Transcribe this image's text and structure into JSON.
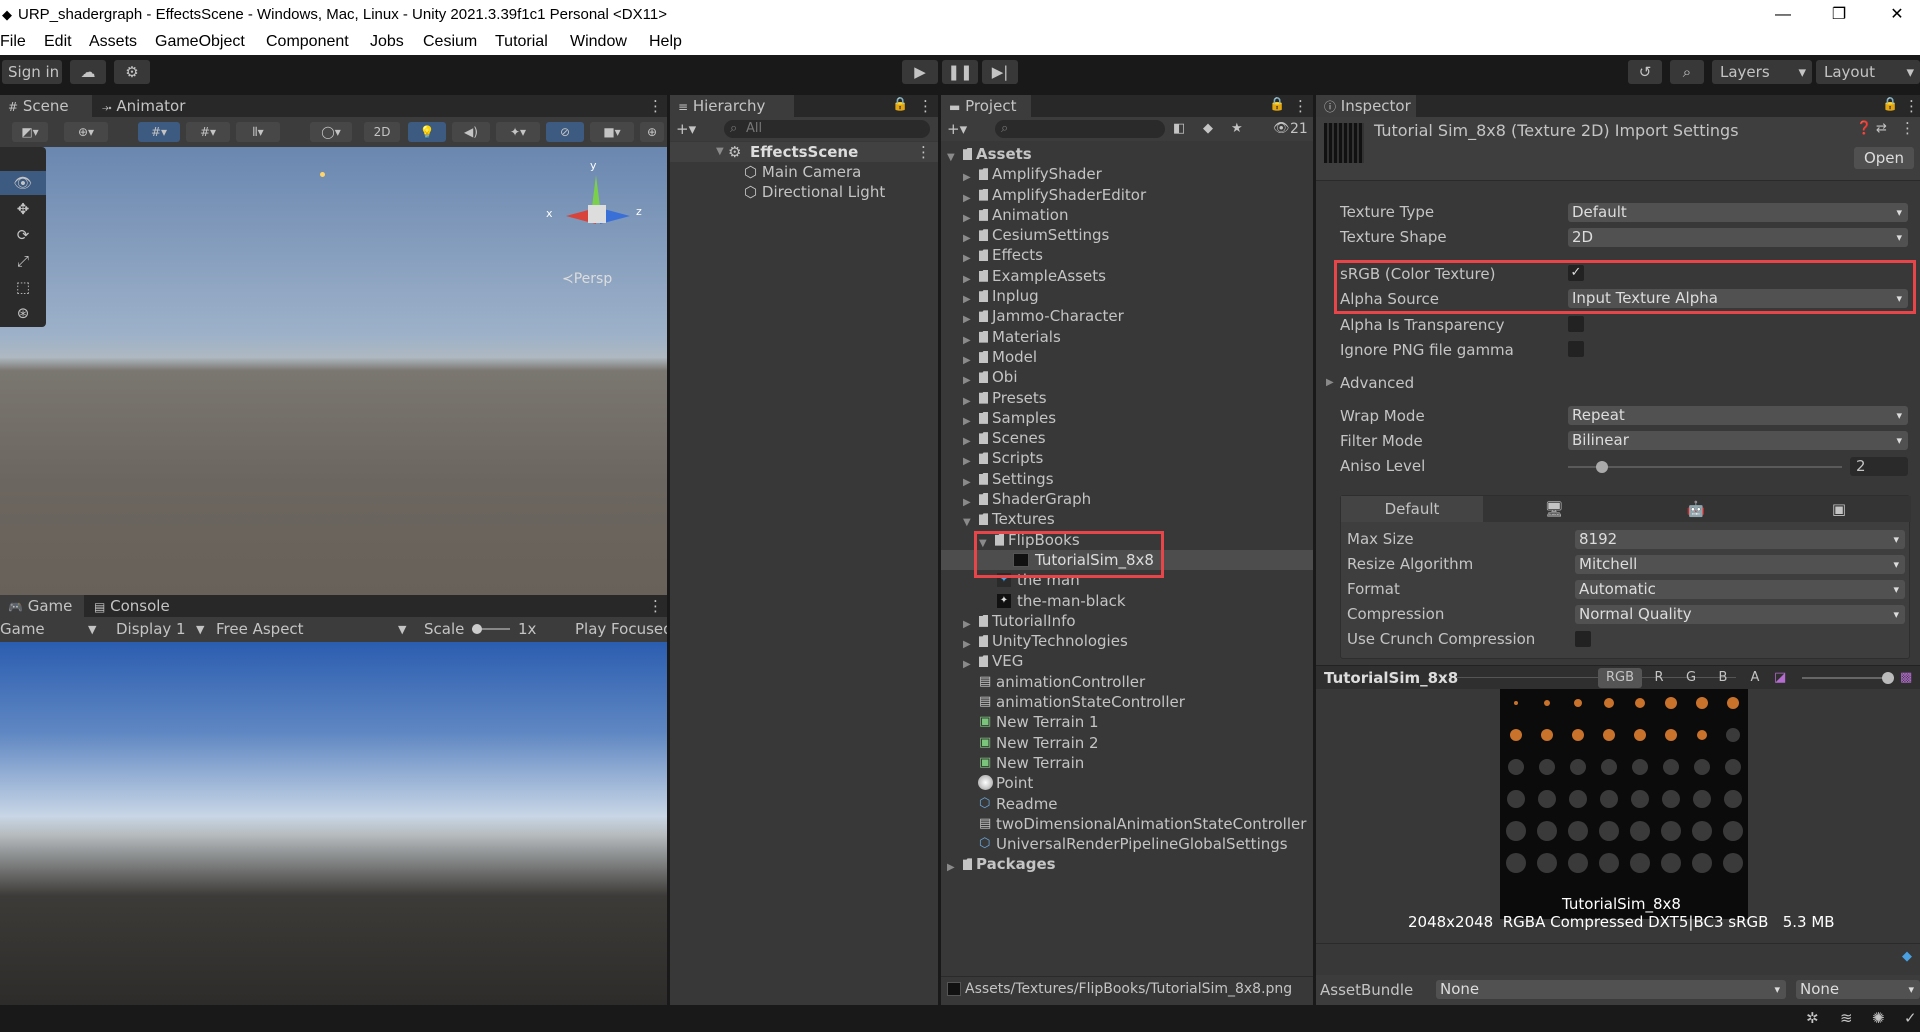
{
  "window": {
    "title": "URP_shadergraph - EffectsScene - Windows, Mac, Linux - Unity 2021.3.39f1c1 Personal <DX11>",
    "minimize": "—",
    "maximize": "❐",
    "close": "✕"
  },
  "menu": [
    "File",
    "Edit",
    "Assets",
    "GameObject",
    "Component",
    "Jobs",
    "Cesium",
    "Tutorial",
    "Window",
    "Help"
  ],
  "toolbar": {
    "sign_in": "Sign in",
    "layers": "Layers",
    "layout": "Layout"
  },
  "scene": {
    "tabs": [
      "Scene",
      "Animator"
    ],
    "persp": "≺Persp",
    "twod": "2D",
    "gizmo": {
      "x": "x",
      "y": "y",
      "z": "z"
    }
  },
  "game": {
    "tabs": [
      "Game",
      "Console"
    ],
    "mode": "Game",
    "display": "Display 1",
    "aspect": "Free Aspect",
    "scale_label": "Scale",
    "scale_value": "1x",
    "play_focused": "Play Focused"
  },
  "hierarchy": {
    "tab": "Hierarchy",
    "search_placeholder": "All",
    "scene": "EffectsScene",
    "items": [
      "Main Camera",
      "Directional Light"
    ]
  },
  "project": {
    "tab": "Project",
    "hidden_count": "21",
    "root": "Assets",
    "folders": [
      "AmplifyShader",
      "AmplifyShaderEditor",
      "Animation",
      "CesiumSettings",
      "Effects",
      "ExampleAssets",
      "Inplug",
      "Jammo-Character",
      "Materials",
      "Model",
      "Obi",
      "Presets",
      "Samples",
      "Scenes",
      "Scripts",
      "Settings",
      "ShaderGraph"
    ],
    "textures": "Textures",
    "flipbooks": "FlipBooks",
    "selected": "TutorialSim_8x8",
    "texture_items": [
      "the man",
      "the-man-black"
    ],
    "more_folders": [
      "TutorialInfo",
      "UnityTechnologies",
      "VEG"
    ],
    "files": [
      "animationController",
      "animationStateController",
      "New Terrain 1",
      "New Terrain 2",
      "New Terrain",
      "Point",
      "Readme",
      "twoDimensionalAnimationStateController",
      "UniversalRenderPipelineGlobalSettings"
    ],
    "packages": "Packages",
    "path": "Assets/Textures/FlipBooks/TutorialSim_8x8.png"
  },
  "inspector": {
    "tab": "Inspector",
    "title": "Tutorial Sim_8x8 (Texture 2D) Import Settings",
    "open": "Open",
    "texture_type_label": "Texture Type",
    "texture_type": "Default",
    "texture_shape_label": "Texture Shape",
    "texture_shape": "2D",
    "srgb_label": "sRGB (Color Texture)",
    "srgb_check": "✓",
    "alpha_source_label": "Alpha Source",
    "alpha_source": "Input Texture Alpha",
    "alpha_transparency_label": "Alpha Is Transparency",
    "ignore_png_label": "Ignore PNG file gamma",
    "advanced": "Advanced",
    "wrap_mode_label": "Wrap Mode",
    "wrap_mode": "Repeat",
    "filter_mode_label": "Filter Mode",
    "filter_mode": "Bilinear",
    "aniso_label": "Aniso Level",
    "aniso": "2",
    "aniso_fraction": 0.125,
    "platform_tab": "Default",
    "max_size_label": "Max Size",
    "max_size": "8192",
    "resize_label": "Resize Algorithm",
    "resize": "Mitchell",
    "format_label": "Format",
    "format": "Automatic",
    "compression_label": "Compression",
    "compression": "Normal Quality",
    "crunch_label": "Use Crunch Compression",
    "preview_title": "TutorialSim_8x8",
    "channels": [
      "RGB",
      "R",
      "G",
      "B",
      "A"
    ],
    "preview_caption": "TutorialSim_8x8",
    "preview_info": "2048x2048  RGBA Compressed DXT5|BC3 sRGB   5.3 MB",
    "assetbundle_label": "AssetBundle",
    "assetbundle": "None",
    "assetbundle_variant": "None"
  }
}
